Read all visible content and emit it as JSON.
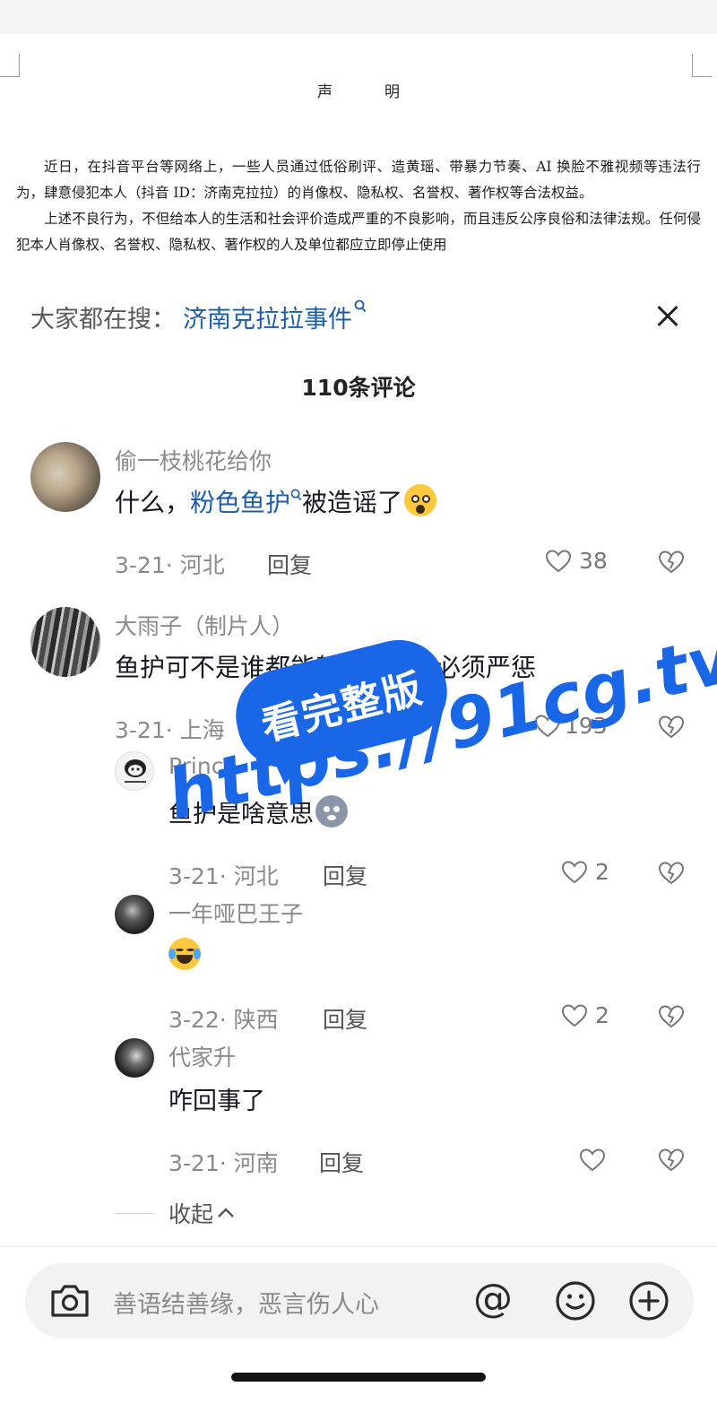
{
  "document": {
    "title": "声明",
    "paragraphs": [
      "近日，在抖音平台等网络上，一些人员通过低俗刷评、造黄瑶、带暴力节奏、AI 换脸不雅视频等违法行为，肆意侵犯本人（抖音 ID：济南克拉拉）的肖像权、隐私权、名誉权、著作权等合法权益。",
      "上述不良行为，不但给本人的生活和社会评价造成严重的不良影响，而且违反公序良俗和法律法规。任何侵犯本人肖像权、名誉权、隐私权、著作权的人及单位都应立即停止使用"
    ]
  },
  "search": {
    "prefix": "大家都在搜：",
    "term": "济南克拉拉事件",
    "mag_icon": "search-icon"
  },
  "close_icon": "close-icon",
  "comment_count": "110条评论",
  "comments": [
    {
      "author": "偷一枝桃花给你",
      "text_before": "什么，",
      "text_link": "粉色鱼护",
      "text_after": "被造谣了",
      "emoji": "astonished-emoji",
      "date_loc": "3-21· 河北",
      "reply": "回复",
      "likes": "38"
    },
    {
      "author": "大雨子（制片人）",
      "text": "鱼护可不是谁都能驾驭的",
      "text_tail": "必须严惩",
      "emoji": "crying-emoji",
      "date_loc": "3-21· 上海",
      "reply": "回复",
      "likes": "193"
    },
    {
      "author": "Prince",
      "text": "鱼护是啥意思",
      "emoji": "dog-emoji",
      "date_loc": "3-21· 河北",
      "reply": "回复",
      "likes": "2"
    },
    {
      "author": "一年哑巴王子",
      "emoji": "laughing-tears-emoji",
      "date_loc": "3-22· 陕西",
      "reply": "回复",
      "likes": "2"
    },
    {
      "author": "代家升",
      "text": "咋回事了",
      "date_loc": "3-21· 河南",
      "reply": "回复"
    }
  ],
  "collapse_label": "收起",
  "input": {
    "placeholder": "善语结善缘，恶言伤人心",
    "at": "@"
  },
  "watermark": {
    "bubble": "看完整版",
    "url": "https://91cg.tv"
  },
  "colors": {
    "link_blue": "#1f5ca8",
    "watermark_blue": "#1967e6",
    "muted_text": "#8a8a8a"
  }
}
